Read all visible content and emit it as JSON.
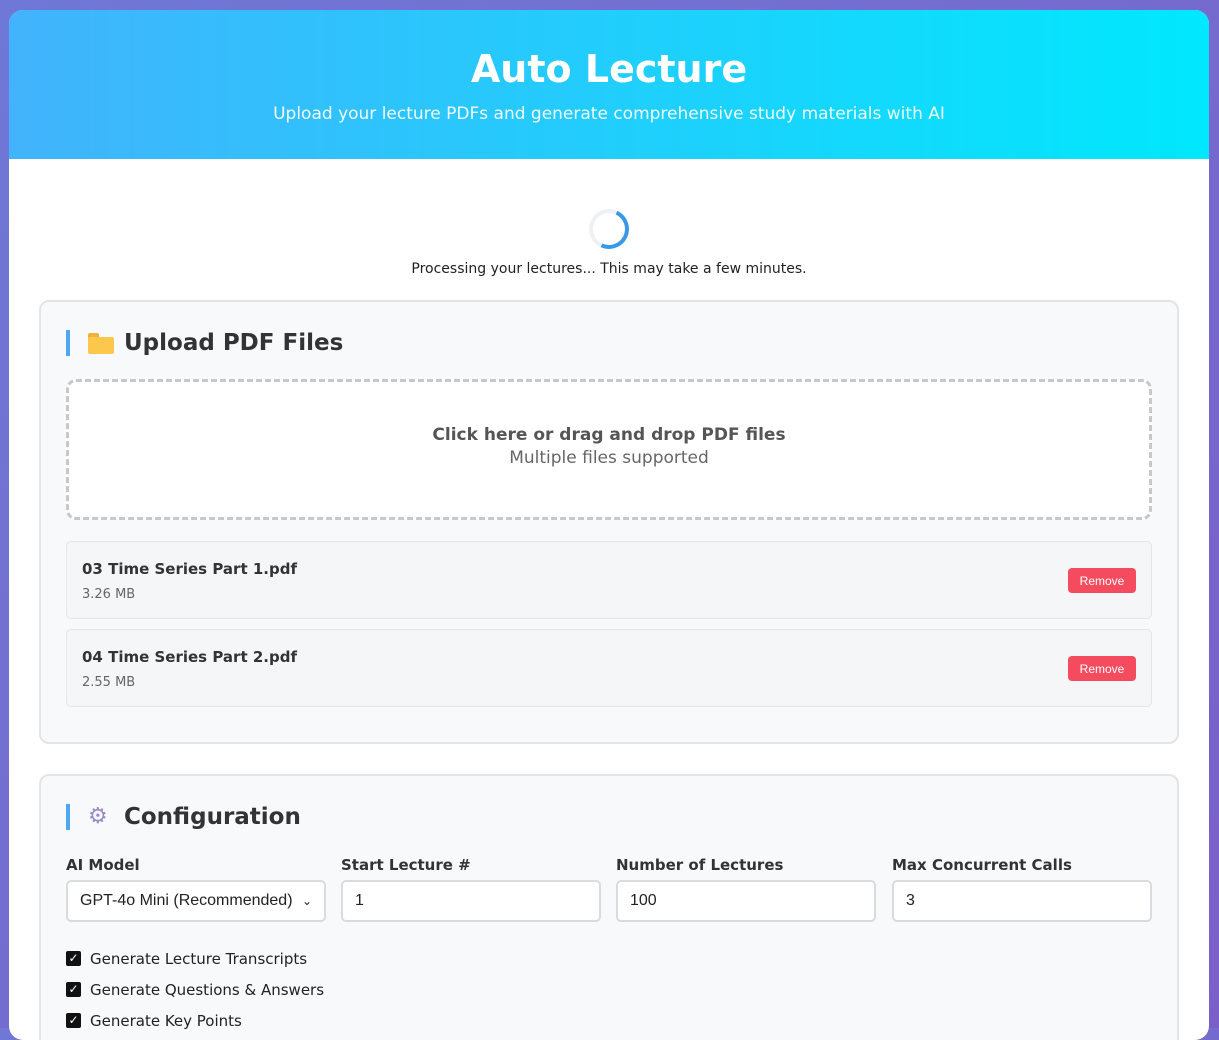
{
  "header": {
    "title": "Auto Lecture",
    "subtitle": "Upload your lecture PDFs and generate comprehensive study materials with AI"
  },
  "loading": {
    "text": "Processing your lectures... This may take a few minutes."
  },
  "upload": {
    "title": "Upload PDF Files",
    "icon": "folder-icon",
    "dropzone_main": "Click here or drag and drop PDF files",
    "dropzone_sub": "Multiple files supported",
    "files": [
      {
        "name": "03 Time Series Part 1.pdf",
        "size": "3.26 MB",
        "remove_label": "Remove"
      },
      {
        "name": "04 Time Series Part 2.pdf",
        "size": "2.55 MB",
        "remove_label": "Remove"
      }
    ]
  },
  "config": {
    "title": "Configuration",
    "icon": "gear-icon",
    "fields": [
      {
        "label": "AI Model",
        "value": "GPT-4o Mini (Recommended)"
      },
      {
        "label": "Start Lecture #",
        "value": "1"
      },
      {
        "label": "Number of Lectures",
        "value": "100"
      },
      {
        "label": "Max Concurrent Calls",
        "value": "3"
      }
    ],
    "options": [
      {
        "label": "Generate Lecture Transcripts",
        "checked": true
      },
      {
        "label": "Generate Questions & Answers",
        "checked": true
      },
      {
        "label": "Generate Key Points",
        "checked": true
      }
    ]
  },
  "colors": {
    "header_start": "#42b3fc",
    "header_end": "#00e8fd",
    "accent": "#4fa6f2",
    "remove": "#f54b5e"
  }
}
